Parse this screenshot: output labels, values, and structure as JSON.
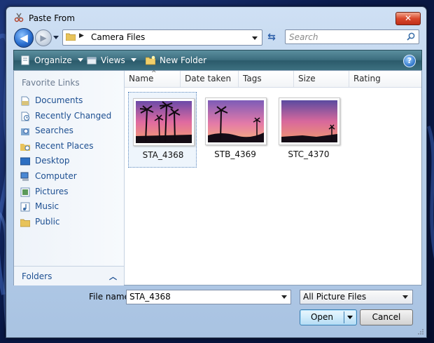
{
  "window": {
    "title": "Paste From",
    "close_label": "✕"
  },
  "nav": {
    "path_segment": "Camera Files",
    "search_placeholder": "Search"
  },
  "toolbar": {
    "organize": "Organize",
    "views": "Views",
    "new_folder": "New Folder",
    "help": "?"
  },
  "sidebar": {
    "title": "Favorite Links",
    "items": [
      {
        "label": "Documents",
        "icon": "documents-icon"
      },
      {
        "label": "Recently Changed",
        "icon": "recently-changed-icon"
      },
      {
        "label": "Searches",
        "icon": "searches-icon"
      },
      {
        "label": "Recent Places",
        "icon": "recent-places-icon"
      },
      {
        "label": "Desktop",
        "icon": "desktop-icon"
      },
      {
        "label": "Computer",
        "icon": "computer-icon"
      },
      {
        "label": "Pictures",
        "icon": "pictures-icon"
      },
      {
        "label": "Music",
        "icon": "music-icon"
      },
      {
        "label": "Public",
        "icon": "public-folder-icon"
      }
    ],
    "folders_label": "Folders"
  },
  "columns": [
    "Name",
    "Date taken",
    "Tags",
    "Size",
    "Rating"
  ],
  "files": [
    {
      "name": "STA_4368",
      "selected": true
    },
    {
      "name": "STB_4369",
      "selected": false
    },
    {
      "name": "STC_4370",
      "selected": false
    }
  ],
  "footer": {
    "file_name_label": "File name:",
    "file_name_value": "STA_4368",
    "file_type": "All Picture Files",
    "open": "Open",
    "cancel": "Cancel"
  },
  "colors": {
    "toolbar": "#3c6d7e",
    "link": "#1d4f91",
    "close": "#d9482c"
  }
}
